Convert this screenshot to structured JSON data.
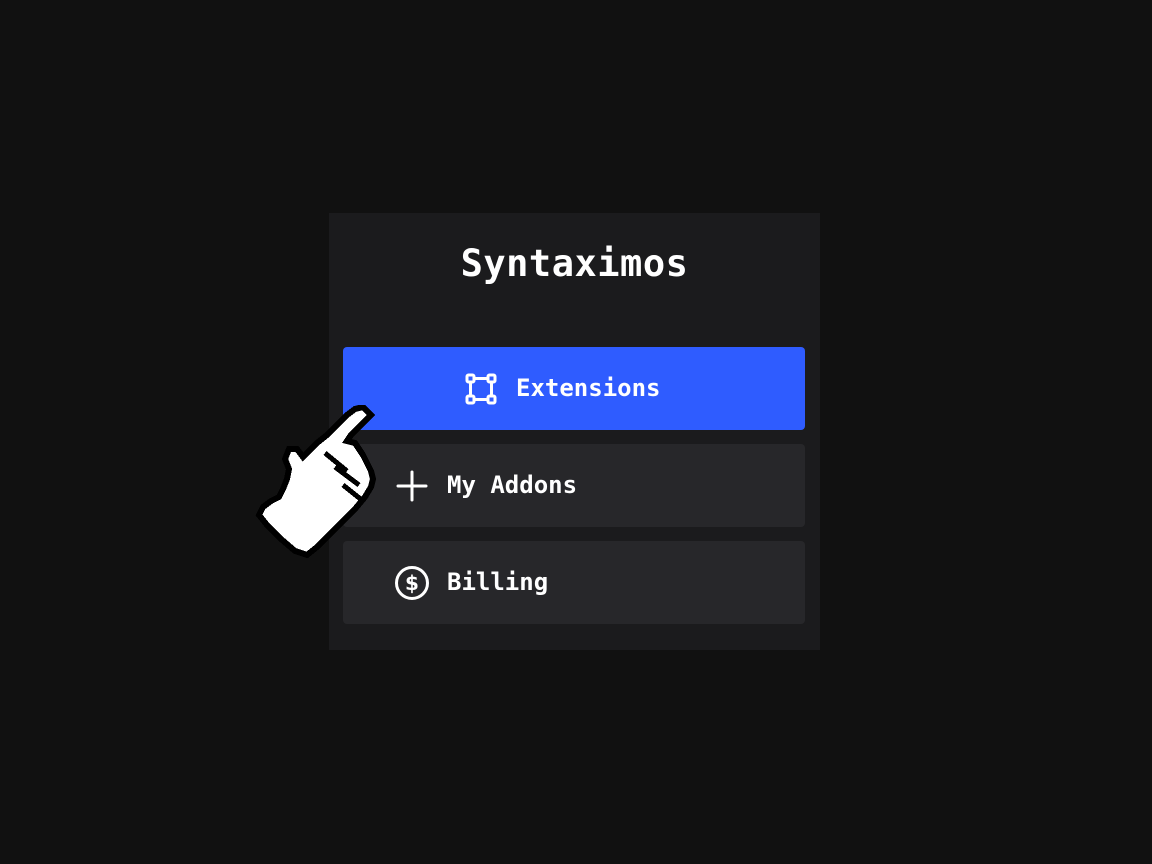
{
  "app": {
    "name": "Syntaximos"
  },
  "nav": {
    "items": [
      {
        "label": "Extensions",
        "icon": "extensions-icon",
        "active": true
      },
      {
        "label": "My Addons",
        "icon": "plus-icon",
        "active": false
      },
      {
        "label": "Billing",
        "icon": "dollar-circle-icon",
        "active": false
      }
    ]
  },
  "colors": {
    "background": "#111111",
    "panel": "#1b1b1d",
    "item": "#27272a",
    "accent": "#2f5cff",
    "text": "#ffffff"
  },
  "cursor": {
    "icon": "hand-pointer-cursor"
  }
}
